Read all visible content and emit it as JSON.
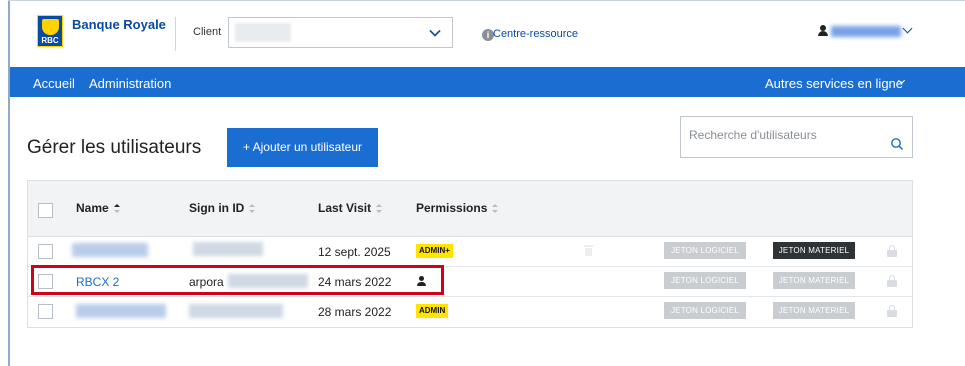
{
  "header": {
    "logo_text": "RBC",
    "brand_name": "Banque Royale",
    "client_label": "Client",
    "resource_link": "Centre-ressource"
  },
  "nav": {
    "home": "Accueil",
    "admin": "Administration",
    "other_services": "Autres services en ligne"
  },
  "page": {
    "title": "Gérer les utilisateurs",
    "add_user_button": "+ Ajouter un utilisateur",
    "search_placeholder": "Recherche d'utilisateurs"
  },
  "table": {
    "columns": {
      "name": "Name",
      "sign_in_id": "Sign in ID",
      "last_visit": "Last Visit",
      "permissions": "Permissions"
    },
    "rows": [
      {
        "name": "",
        "sign_in_id": "",
        "last_visit": "12 sept. 2025",
        "permission_badge": "ADMIN+",
        "software_token": "JETON LOGICIEL",
        "hardware_token": "JETON MATERIEL",
        "hardware_token_active": true
      },
      {
        "name": "RBCX 2",
        "sign_in_id": "arpora",
        "last_visit": "24 mars 2022",
        "permission_badge": "",
        "software_token": "JETON LOGICIEL",
        "hardware_token": "JETON MATERIEL",
        "hardware_token_active": false
      },
      {
        "name": "",
        "sign_in_id": "",
        "last_visit": "28 mars 2022",
        "permission_badge": "ADMIN",
        "software_token": "JETON LOGICIEL",
        "hardware_token": "JETON MATERIEL",
        "hardware_token_active": false
      }
    ]
  },
  "colors": {
    "brand_blue": "#1a6dd1",
    "badge_yellow": "#ffe400",
    "highlight_red": "#d0021b"
  }
}
